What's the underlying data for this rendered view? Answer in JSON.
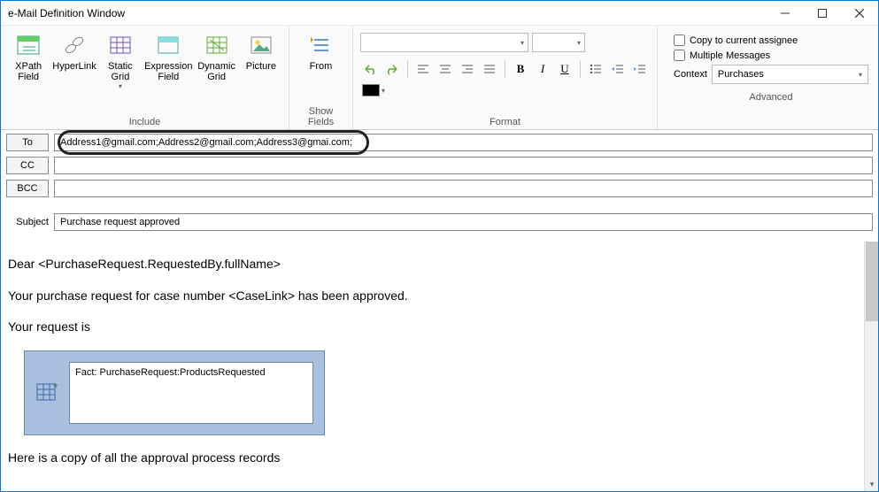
{
  "window": {
    "title": "e-Mail Definition Window"
  },
  "ribbon": {
    "include": {
      "label": "Include",
      "xpath": "XPath\nField",
      "hyperlink": "HyperLink",
      "staticgrid": "Static\nGrid",
      "expressionfield": "Expression\nField",
      "dynamicgrid": "Dynamic\nGrid",
      "picture": "Picture"
    },
    "showfields": {
      "label": "Show Fields",
      "from": "From"
    },
    "format": {
      "label": "Format"
    },
    "advanced": {
      "label": "Advanced",
      "copy": "Copy to current assignee",
      "multi": "Multiple Messages",
      "context_label": "Context",
      "context_value": "Purchases"
    }
  },
  "address": {
    "to_btn": "To",
    "to_value": "Address1@gmail.com;Address2@gmail.com;Address3@gmai.com;",
    "cc_btn": "CC",
    "cc_value": "",
    "bcc_btn": "BCC",
    "bcc_value": "",
    "subject_label": "Subject",
    "subject_value": "Purchase request approved"
  },
  "body": {
    "p1": "Dear <PurchaseRequest.RequestedBy.fullName>",
    "p2": "Your purchase request for case number <CaseLink> has been approved.",
    "p3": "Your request is",
    "fact": "Fact: PurchaseRequest:ProductsRequested",
    "p4": "Here is a copy of all the approval process records"
  }
}
